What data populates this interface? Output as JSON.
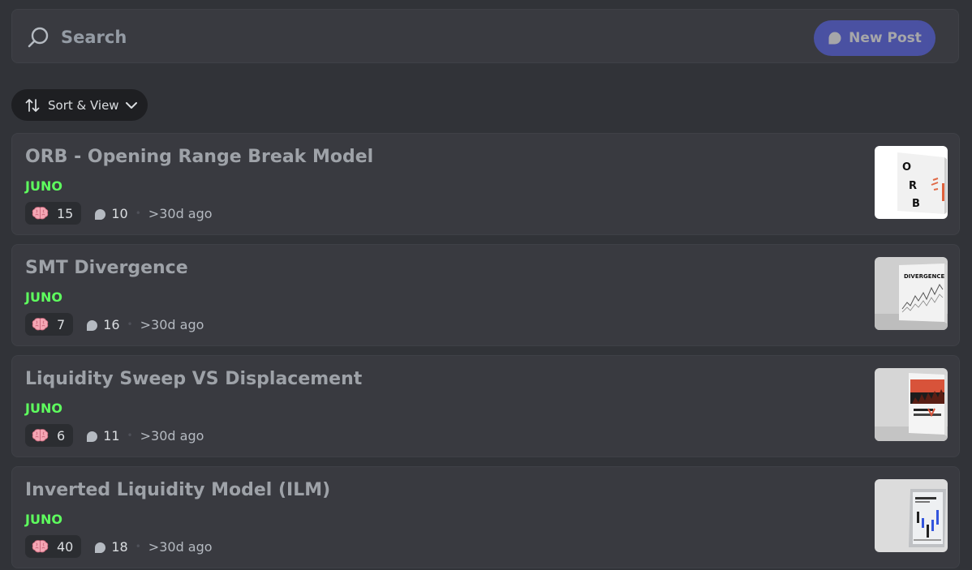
{
  "search": {
    "placeholder": "Search"
  },
  "new_post": {
    "label": "New Post"
  },
  "sort": {
    "label": "Sort & View"
  },
  "posts": [
    {
      "title": "ORB - Opening Range Break Model",
      "author": "JUNO",
      "reactions": "15",
      "comments": "10",
      "time": ">30d ago"
    },
    {
      "title": "SMT Divergence",
      "author": "JUNO",
      "reactions": "7",
      "comments": "16",
      "time": ">30d ago"
    },
    {
      "title": "Liquidity Sweep VS Displacement",
      "author": "JUNO",
      "reactions": "6",
      "comments": "11",
      "time": ">30d ago"
    },
    {
      "title": "Inverted Liquidity Model (ILM)",
      "author": "JUNO",
      "reactions": "40",
      "comments": "18",
      "time": ">30d ago"
    }
  ],
  "thumbnails": {
    "orb_letters": [
      "O",
      "R",
      "B"
    ],
    "smt_heading": "DIVERGENCE"
  },
  "colors": {
    "background": "#313338",
    "card": "#393a40",
    "accent": "#5865f2",
    "author": "#5eff5e",
    "title": "#9ea2a8"
  },
  "icons": {
    "search": "search-icon",
    "new_post": "chat-bubble-icon",
    "sort": "sort-arrows-icon",
    "chevron": "chevron-down-icon",
    "reaction": "brain-icon",
    "comments": "chat-bubble-icon"
  }
}
